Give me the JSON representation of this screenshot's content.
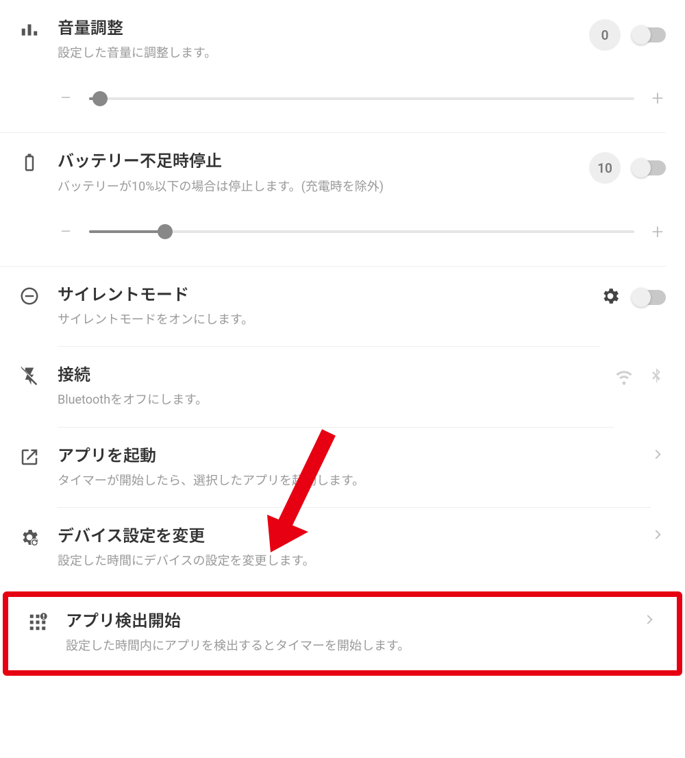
{
  "settings": [
    {
      "key": "volume",
      "title": "音量調整",
      "subtitle": "設定した音量に調整します。",
      "badge": "0",
      "slider_percent": 2
    },
    {
      "key": "battery",
      "title": "バッテリー不足時停止",
      "subtitle": "バッテリーが10%以下の場合は停止します。(充電時を除外)",
      "badge": "10",
      "slider_percent": 14
    },
    {
      "key": "silent",
      "title": "サイレントモード",
      "subtitle": "サイレントモードをオンにします。"
    },
    {
      "key": "connection",
      "title": "接続",
      "subtitle": "Bluetoothをオフにします。"
    },
    {
      "key": "launch_app",
      "title": "アプリを起動",
      "subtitle": "タイマーが開始したら、選択したアプリを起動します。"
    },
    {
      "key": "device_settings",
      "title": "デバイス設定を変更",
      "subtitle": "設定した時間にデバイスの設定を変更します。"
    },
    {
      "key": "app_detect",
      "title": "アプリ検出開始",
      "subtitle": "設定した時間内にアプリを検出するとタイマーを開始します。"
    }
  ]
}
